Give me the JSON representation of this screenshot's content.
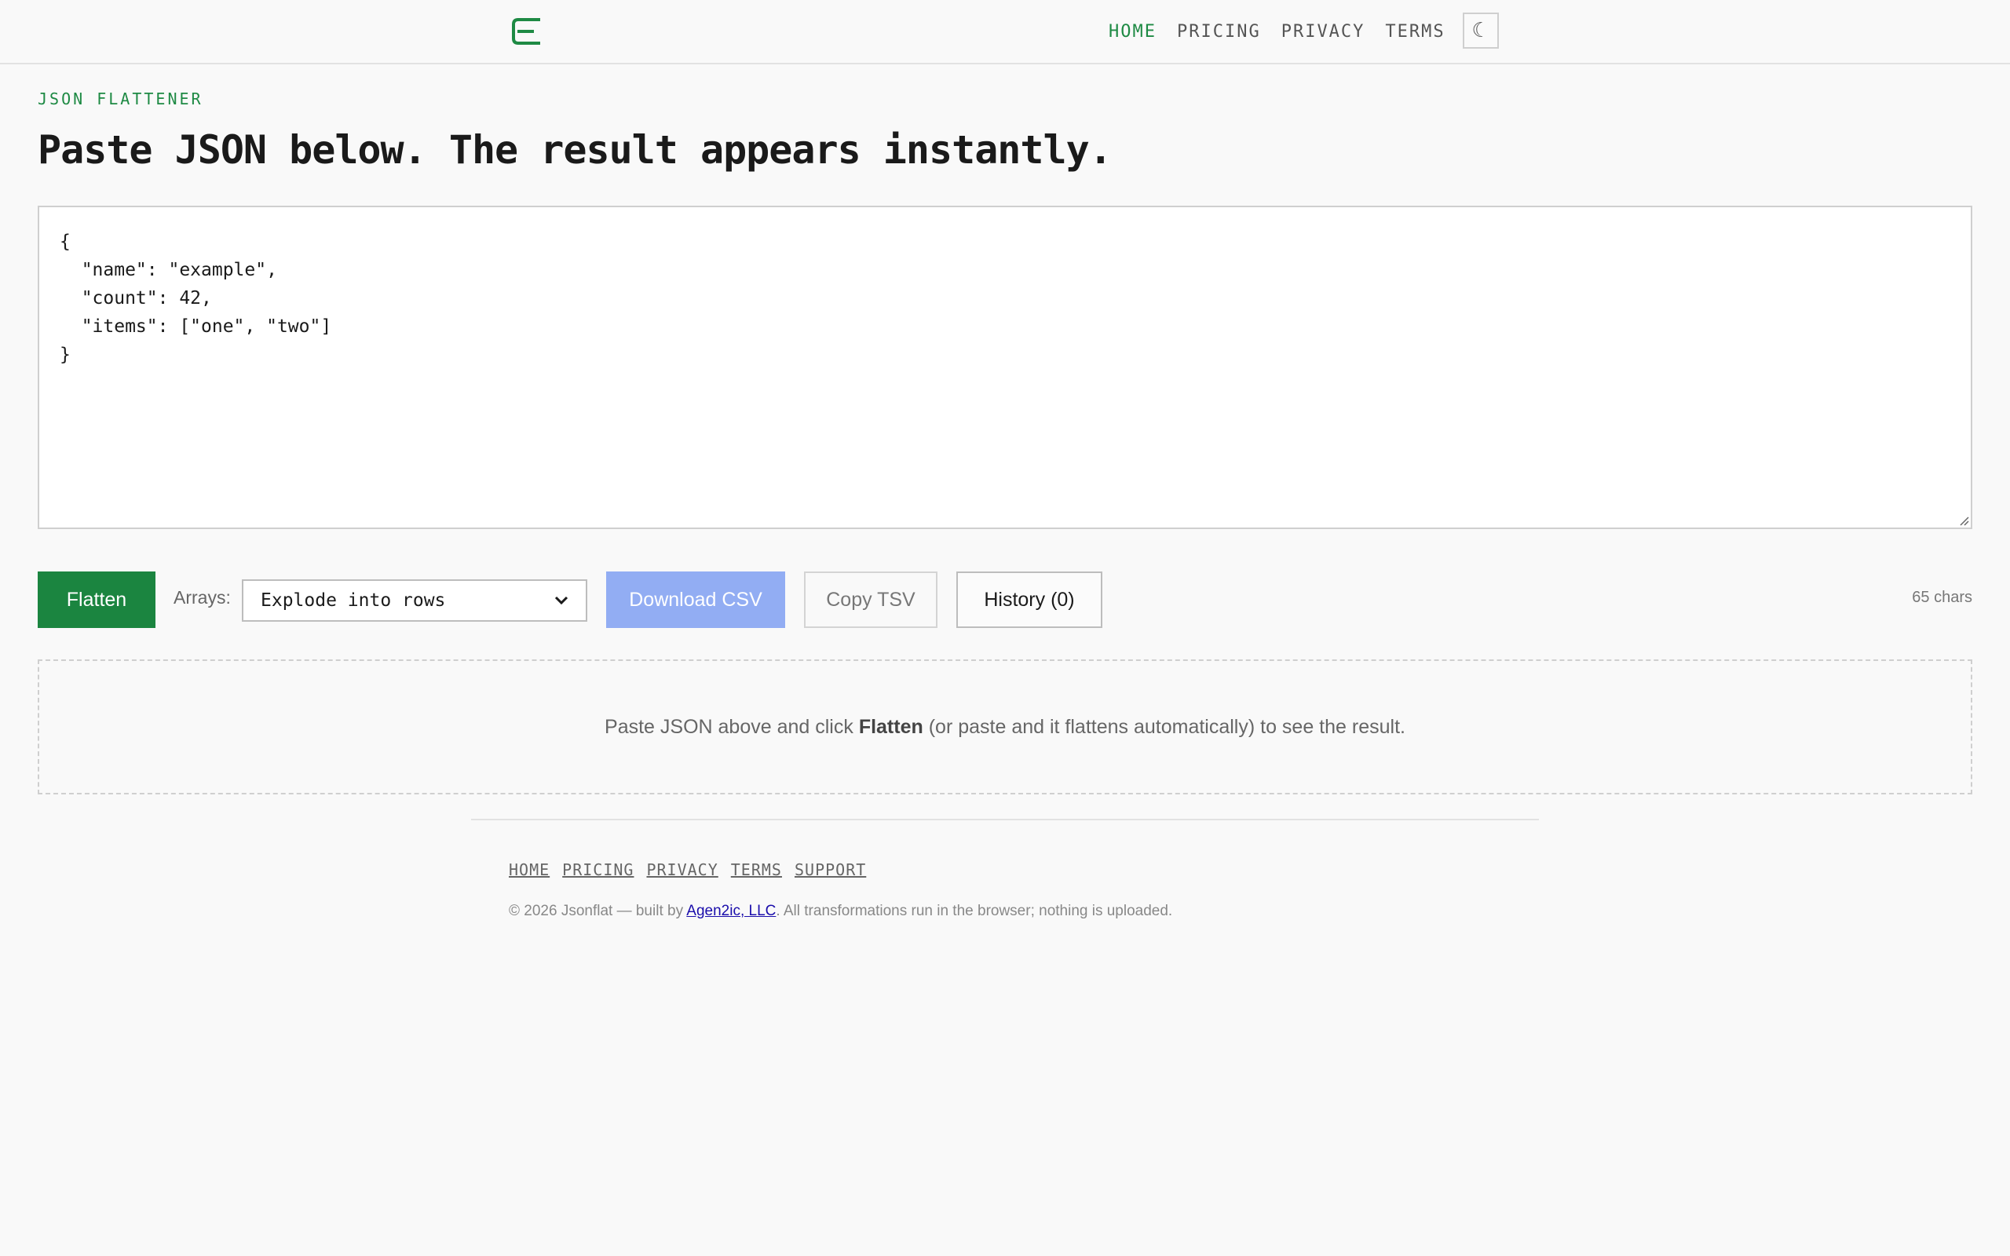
{
  "header": {
    "nav": [
      "HOME",
      "PRICING",
      "PRIVACY",
      "TERMS"
    ],
    "active_nav": "HOME",
    "theme_toggle_glyph": "☾"
  },
  "hero": {
    "eyebrow": "JSON FLATTENER",
    "title": "Paste JSON below. The result appears instantly."
  },
  "editor": {
    "value": "{\n  \"name\": \"example\",\n  \"count\": 42,\n  \"items\": [\"one\", \"two\"]\n}"
  },
  "toolbar": {
    "flatten_label": "Flatten",
    "arrays_label": "Arrays:",
    "arrays_selected": "Explode into rows",
    "download_csv_label": "Download CSV",
    "copy_tsv_label": "Copy TSV",
    "history_label": "History (0)",
    "char_count": "65 chars"
  },
  "result": {
    "before": "Paste JSON above and click ",
    "bold": "Flatten",
    "after": " (or paste and it flattens automatically) to see the result."
  },
  "footer": {
    "links": [
      "HOME",
      "PRICING",
      "PRIVACY",
      "TERMS",
      "SUPPORT"
    ],
    "copy_before": "© 2026 Jsonflat — built by ",
    "company": "Agen2ic, LLC",
    "copy_after": ". All transformations run in the browser; nothing is uploaded."
  },
  "colors": {
    "accent": "#1e8a44",
    "primary_button": "#1b8540",
    "disabled_button": "#92adf3",
    "background": "#f9f9f9"
  }
}
